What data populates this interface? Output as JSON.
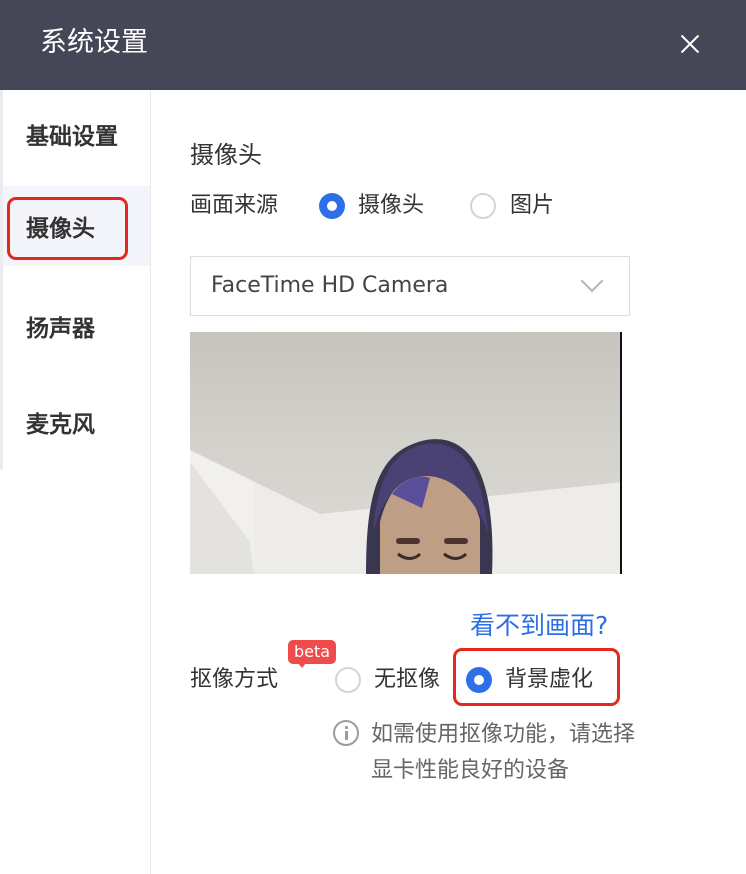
{
  "window": {
    "title": "系统设置"
  },
  "sidebar": {
    "items": [
      {
        "label": "基础设置"
      },
      {
        "label": "摄像头"
      },
      {
        "label": "扬声器"
      },
      {
        "label": "麦克风"
      }
    ],
    "active": "摄像头"
  },
  "camera": {
    "section_title": "摄像头",
    "source_label": "画面来源",
    "source_options": [
      {
        "label": "摄像头",
        "selected": true
      },
      {
        "label": "图片",
        "selected": false
      }
    ],
    "device_select": {
      "value": "FaceTime HD Camera"
    },
    "help_link": "看不到画面?",
    "matting": {
      "label": "抠像方式",
      "badge": "beta",
      "options": [
        {
          "label": "无抠像",
          "selected": false
        },
        {
          "label": "背景虚化",
          "selected": true
        }
      ],
      "note_line1": "如需使用抠像功能，请选择",
      "note_line2": "显卡性能良好的设备"
    }
  },
  "colors": {
    "titlebar": "#454656",
    "accent": "#2c6fe6",
    "highlight": "#e3291d",
    "badge": "#ef4b4b"
  }
}
